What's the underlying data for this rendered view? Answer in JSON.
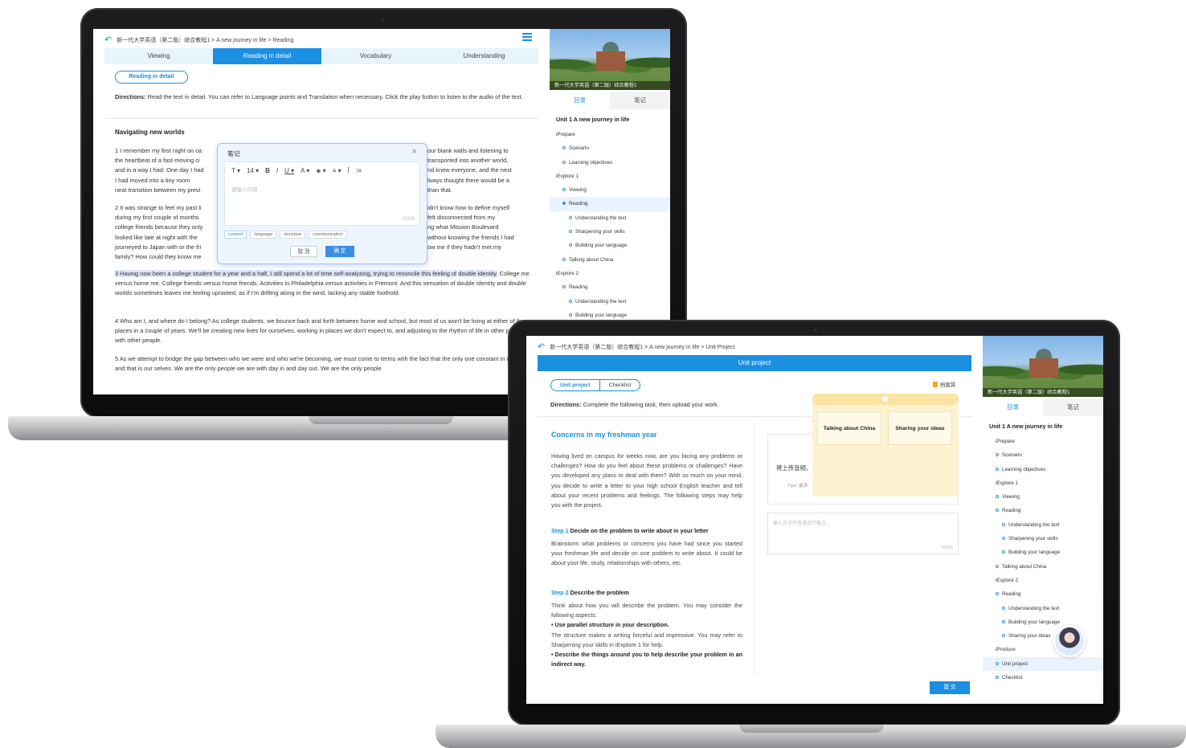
{
  "screen1": {
    "breadcrumb": "新一代大学英语（第二版）综合教程1 > A new journey in life > Reading",
    "tabs": [
      "Viewing",
      "Reading in detail",
      "Vocabulary",
      "Understanding"
    ],
    "pill": "Reading in detail",
    "directions_label": "Directions:",
    "directions": "Read the text in detail. You can refer to Language points and Translation when necessary. Click the play button to listen to the audio of the text.",
    "title": "Navigating new worlds",
    "p1a": "1  I remember my first night on ca",
    "p1b": "the heartbeat of a fast-moving ci",
    "p1c": "and in a way I had: One day I had",
    "p1d": "I had moved into a tiny room",
    "p1e": "neat transition between my previ",
    "p1r1": "our blank walls and listening to",
    "p1r2": "transported into another world,",
    "p1r3": "nd knew everyone, and the next",
    "p1r4": "lways thought there would be a",
    "p1r5": "than that.",
    "p2a": "2  It was strange to feel my past li",
    "p2b": "during my first couple of months",
    "p2c": "college friends because they only",
    "p2d": "looked like late at night with the",
    "p2e": "journeyed to Japan with or the fri",
    "p2f": "family? How could they know me",
    "p2r1": "idn't know how to define myself",
    "p2r2": "felt disconnected from my",
    "p2r3": "ng what Mission Boulevard",
    "p2r4": "without knowing the friends I had",
    "p2r5": "ow me if they hadn't met my",
    "p3_highlight": "3  Having now been a college student for a year and a half, I still spend a lot of time self-analyzing, trying to reconcile this feeling of",
    "p3_highlight2": "double identity.",
    "p3_rest": " College me versus home me. College friends versus home friends. Activities in Philadelphia versus activities in Fremont. And this sensation of double identity and double worlds sometimes leaves me feeling uprooted, as if I'm drifting along in the wind, lacking any stable foothold.",
    "p4": "4  Who am I, and where do I belong? As college students, we bounce back and forth between home and school, but most of us won't be living at either of those places in a couple of years. We'll be creating new lives for ourselves, working in places we don't expect to, and adjusting to the rhythm of life in other places with other people.",
    "p5": "5  As we attempt to bridge the gap between who we were and who we're becoming, we must come to terms with the fact that the only one constant in our lives, and that is our selves. We are the only people we are with day in and day out. We are the only people",
    "note": {
      "title": "笔记",
      "close": "×",
      "toolbar": [
        "T ▾",
        "14 ▾",
        "B",
        "I",
        "U ▾",
        "A ▾",
        "◈ ▾",
        "≡ ▾",
        "Ī",
        "⁝≡"
      ],
      "placeholder": "请输入内容",
      "counter": "0/300",
      "tags": [
        "content",
        "language",
        "structure",
        "communication"
      ],
      "cancel": "取 消",
      "confirm": "确 定"
    },
    "sidebar": {
      "banner_caption": "新一代大学英语（第二版）综合教程1",
      "tabs": [
        "目录",
        "笔记"
      ],
      "unit": "Unit 1 A new journey in life",
      "items": [
        "iPrepare",
        "Scenario",
        "Learning objectives",
        "iExplore 1",
        "Viewing",
        "Reading",
        "Understanding the text",
        "Sharpening your skills",
        "Building your language",
        "Talking about China",
        "iExplore 2",
        "Reading",
        "Understanding the text",
        "Building your language"
      ]
    }
  },
  "screen2": {
    "breadcrumb": "新一代大学英语（第二版）综合教程1 > A new journey in life > Unit Project",
    "bar_title": "Unit project",
    "segments": [
      "Unit project",
      "Checklist"
    ],
    "bag": "档案袋",
    "directions_label": "Directions:",
    "directions": "Complete the following task, then upload your work.",
    "title": "Concerns in my freshman year",
    "intro": "Having lived on campus for weeks now, are you facing any problems or challenges? How do you feel about these problems or challenges? Have you developed any plans to deal with them? With so much on your mind, you decide to write a letter to your high school English teacher and tell about your recent problems and feelings. The following steps may help you with the project.",
    "step1_label": "Step 1",
    "step1_title": "Decide on the problem to write about in your letter",
    "step1_text": "Brainstorm what problems or concerns you have had since you started your freshman life and decide on one problem to write about. It could be about your life, study, relationships with others, etc.",
    "step2_label": "Step 2",
    "step2_title": "Describe the problem",
    "step2_text1": "Think about how you will describe the problem. You may consider the following aspects:",
    "bullet1": "• Use parallel structure in your description.",
    "step2_text2": "The structure makes a writing forceful and impressive. You may refer to Sharpening your skills in iExplore 1 for help.",
    "bullet2": "• Describe the things around you to help describe your problem in an indirect way.",
    "upload_text": "将上传音频、",
    "upload_tip": "Tips:  最多",
    "memo_placeholder": "输入文字作答或进行备注...",
    "memo_counter": "0/500",
    "popup_cards": [
      "Talking about China",
      "Sharing your ideas"
    ],
    "submit": "提 交",
    "sidebar": {
      "banner_caption": "新一代大学英语（第二版）综合教程1",
      "tabs": [
        "目录",
        "笔记"
      ],
      "unit": "Unit 1 A new journey in life",
      "items": [
        "iPrepare",
        "Scenario",
        "Learning objectives",
        "iExplore 1",
        "Viewing",
        "Reading",
        "Understanding the text",
        "Sharpening your skills",
        "Building your language",
        "Talking about China",
        "iExplore 2",
        "Reading",
        "Understanding the text",
        "Building your language",
        "Sharing your ideas",
        "iProduce",
        "Unit project",
        "Checklist"
      ]
    }
  }
}
